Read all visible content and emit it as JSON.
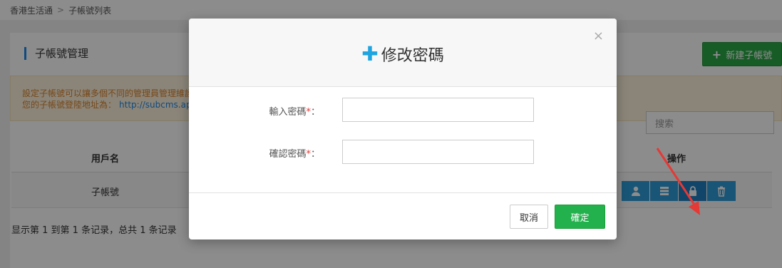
{
  "breadcrumb": {
    "root": "香港生活通",
    "separator": ">",
    "current": "子帳號列表"
  },
  "panel": {
    "title": "子帳號管理",
    "add_button": "新建子帳號",
    "notice_line1": "設定子帳號可以讓多個不同的管理員管理維護",
    "notice_line2_prefix": "您的子帳號登陸地址為：",
    "notice_link": "http://subcms.app"
  },
  "search": {
    "placeholder": "搜索"
  },
  "table": {
    "headers": {
      "user": "用戶名",
      "ops": "操作"
    },
    "rows": [
      {
        "user": "子帳號"
      }
    ],
    "op_icons": [
      "user-icon",
      "list-icon",
      "lock-icon",
      "trash-icon"
    ]
  },
  "footer": {
    "summary": "显示第 1 到第 1 条记录，总共 1 条记录"
  },
  "modal": {
    "title": "修改密碼",
    "close": "×",
    "fields": [
      {
        "label": "輸入密碼",
        "required": "*",
        "colon": "："
      },
      {
        "label": "確認密碼",
        "required": "*",
        "colon": "："
      }
    ],
    "cancel": "取消",
    "confirm": "確定"
  },
  "colors": {
    "accent_green": "#22b14c",
    "accent_blue": "#2f9bd8",
    "arrow_red": "#e53935"
  }
}
